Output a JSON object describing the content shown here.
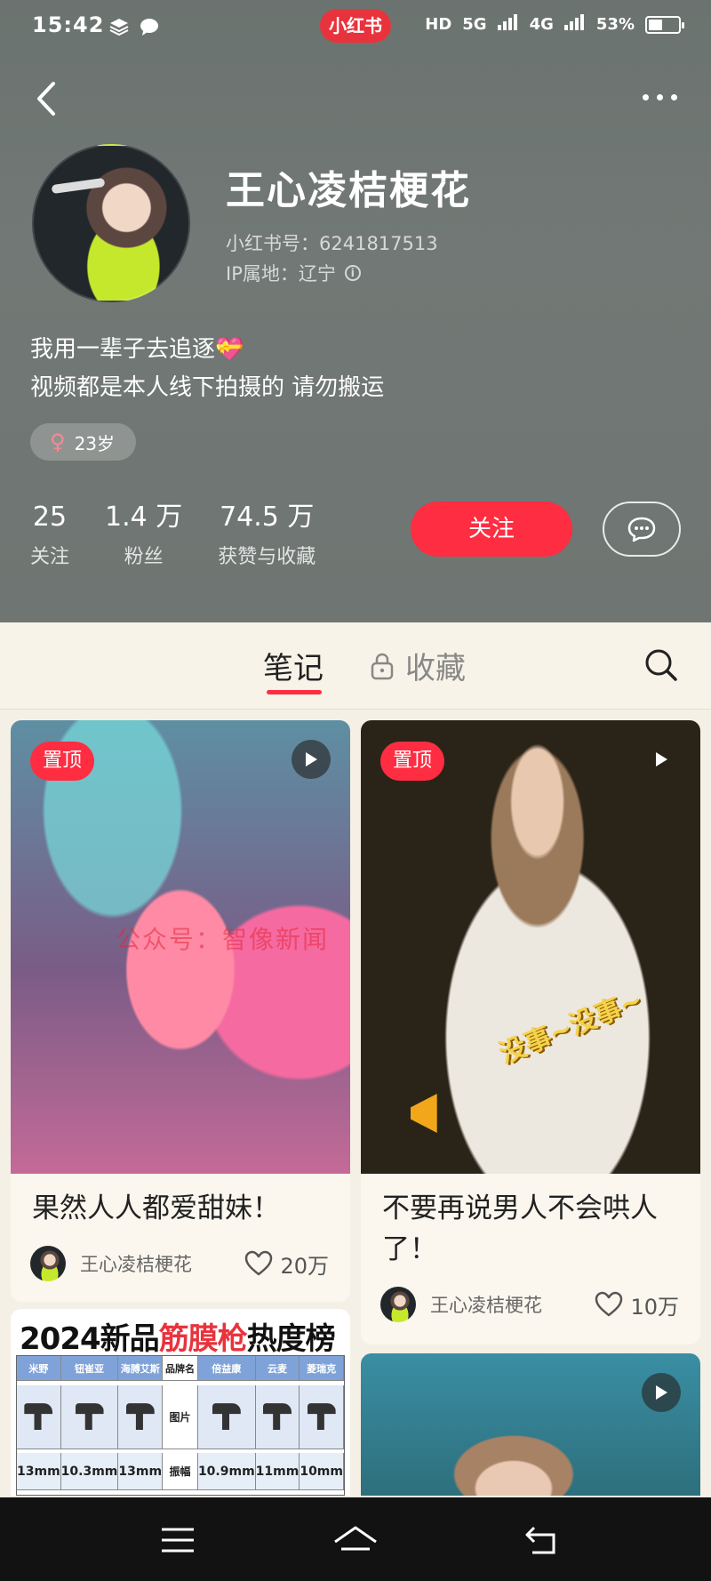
{
  "status_bar": {
    "time": "15:42",
    "app_badge": "小红书",
    "network_1": "HD",
    "network_2": "5G",
    "network_3": "4G",
    "battery": "53%",
    "battery_level": 0.53
  },
  "profile": {
    "nickname": "王心凌桔梗花",
    "red_id": "小红书号：6241817513",
    "ip_location": "IP属地：辽宁",
    "bio_line1": "我用一辈子去追逐💝",
    "bio_line2": "视频都是本人线下拍摄的 请勿搬运",
    "gender_symbol": "♀",
    "age": "23岁"
  },
  "stats": [
    {
      "value": "25",
      "label": "关注"
    },
    {
      "value": "1.4 万",
      "label": "粉丝"
    },
    {
      "value": "74.5 万",
      "label": "获赞与收藏"
    }
  ],
  "actions": {
    "follow_label": "关注"
  },
  "tabs": {
    "notes": "笔记",
    "collect": "收藏"
  },
  "notes": [
    {
      "badge": "置顶",
      "title": "果然人人都爱甜妹！",
      "author": "王心凌桔梗花",
      "likes": "20万",
      "watermark": "公众号：智像新闻"
    },
    {
      "badge": "置顶",
      "title_line1": "不要再说男人不会哄人",
      "title_line2": "了！",
      "author": "王心凌桔梗花",
      "likes": "10万",
      "overlay_text": "没事~没事~"
    }
  ],
  "ranking_image": {
    "title_a": "2024新品",
    "title_b": "筋膜枪",
    "title_c": "热度榜",
    "headers": [
      "米野",
      "钮崔亚",
      "海膊艾斯",
      "品牌名",
      "倍益康",
      "云麦",
      "菱瑞克"
    ],
    "row_pic_label": "图片",
    "row_amp_label": "振幅",
    "amplitudes": [
      "13mm",
      "10.3mm",
      "13mm",
      "振幅",
      "10.9mm",
      "11mm",
      "10mm"
    ]
  },
  "colors": {
    "accent": "#ff2d42",
    "header_bg": "#6f7572",
    "page_bg": "#f5f0e6"
  },
  "icons": {
    "back": "chevron-left-icon",
    "more": "more-dots-icon",
    "chat": "chat-bubble-icon",
    "lock": "lock-icon",
    "search": "search-icon",
    "play": "play-icon",
    "heart": "heart-icon"
  }
}
